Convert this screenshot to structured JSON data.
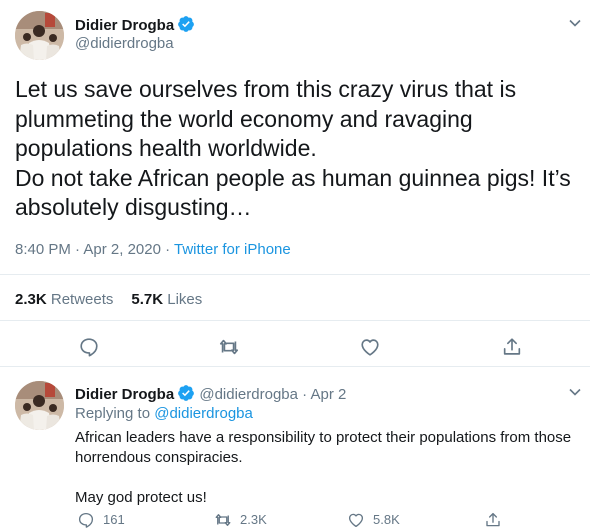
{
  "main_tweet": {
    "author_name": "Didier Drogba",
    "handle": "@didierdrogba",
    "text_lines": [
      "Let us save ourselves from this crazy virus that is",
      "plummeting the world economy and ravaging",
      "populations health worldwide.",
      "Do not take African people as human guinnea pigs! It’s",
      "absolutely disgusting…"
    ],
    "time": "8:40 PM",
    "date": "Apr 2, 2020",
    "source": "Twitter for iPhone",
    "retweets_count": "2.3K",
    "retweets_label": "Retweets",
    "likes_count": "5.7K",
    "likes_label": "Likes"
  },
  "reply_tweet": {
    "author_name": "Didier Drogba",
    "handle": "@didierdrogba",
    "date": "Apr 2",
    "replying_to_label": "Replying to",
    "replying_to_handle": "@didierdrogba",
    "text_line1": "African leaders have a responsibility to protect their populations from those",
    "text_line2": "horrendous conspiracies.",
    "text_line3": "May god protect us!",
    "reply_count": "161",
    "retweet_count": "2.3K",
    "like_count": "5.8K"
  },
  "colors": {
    "link_blue": "#1b95e0",
    "muted_gray": "#657786",
    "divider": "#e6ecf0",
    "verified_badge": "#1da1f2"
  },
  "icons": [
    "verified-badge-icon",
    "chevron-down-icon",
    "reply-icon",
    "retweet-icon",
    "like-icon",
    "share-icon"
  ]
}
